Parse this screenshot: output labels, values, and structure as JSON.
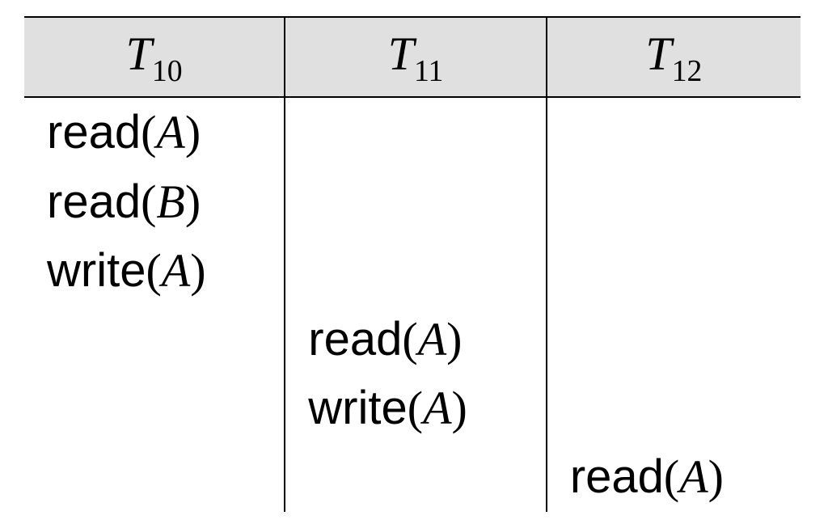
{
  "headers": [
    {
      "var": "T",
      "sub": "10"
    },
    {
      "var": "T",
      "sub": "11"
    },
    {
      "var": "T",
      "sub": "12"
    }
  ],
  "rows": [
    {
      "t10": {
        "op": "read",
        "arg": "A"
      },
      "t11": null,
      "t12": null
    },
    {
      "t10": {
        "op": "read",
        "arg": "B"
      },
      "t11": null,
      "t12": null
    },
    {
      "t10": {
        "op": "write",
        "arg": "A"
      },
      "t11": null,
      "t12": null
    },
    {
      "t10": null,
      "t11": {
        "op": "read",
        "arg": "A"
      },
      "t12": null
    },
    {
      "t10": null,
      "t11": {
        "op": "write",
        "arg": "A"
      },
      "t12": null
    },
    {
      "t10": null,
      "t11": null,
      "t12": {
        "op": "read",
        "arg": "A"
      }
    }
  ]
}
